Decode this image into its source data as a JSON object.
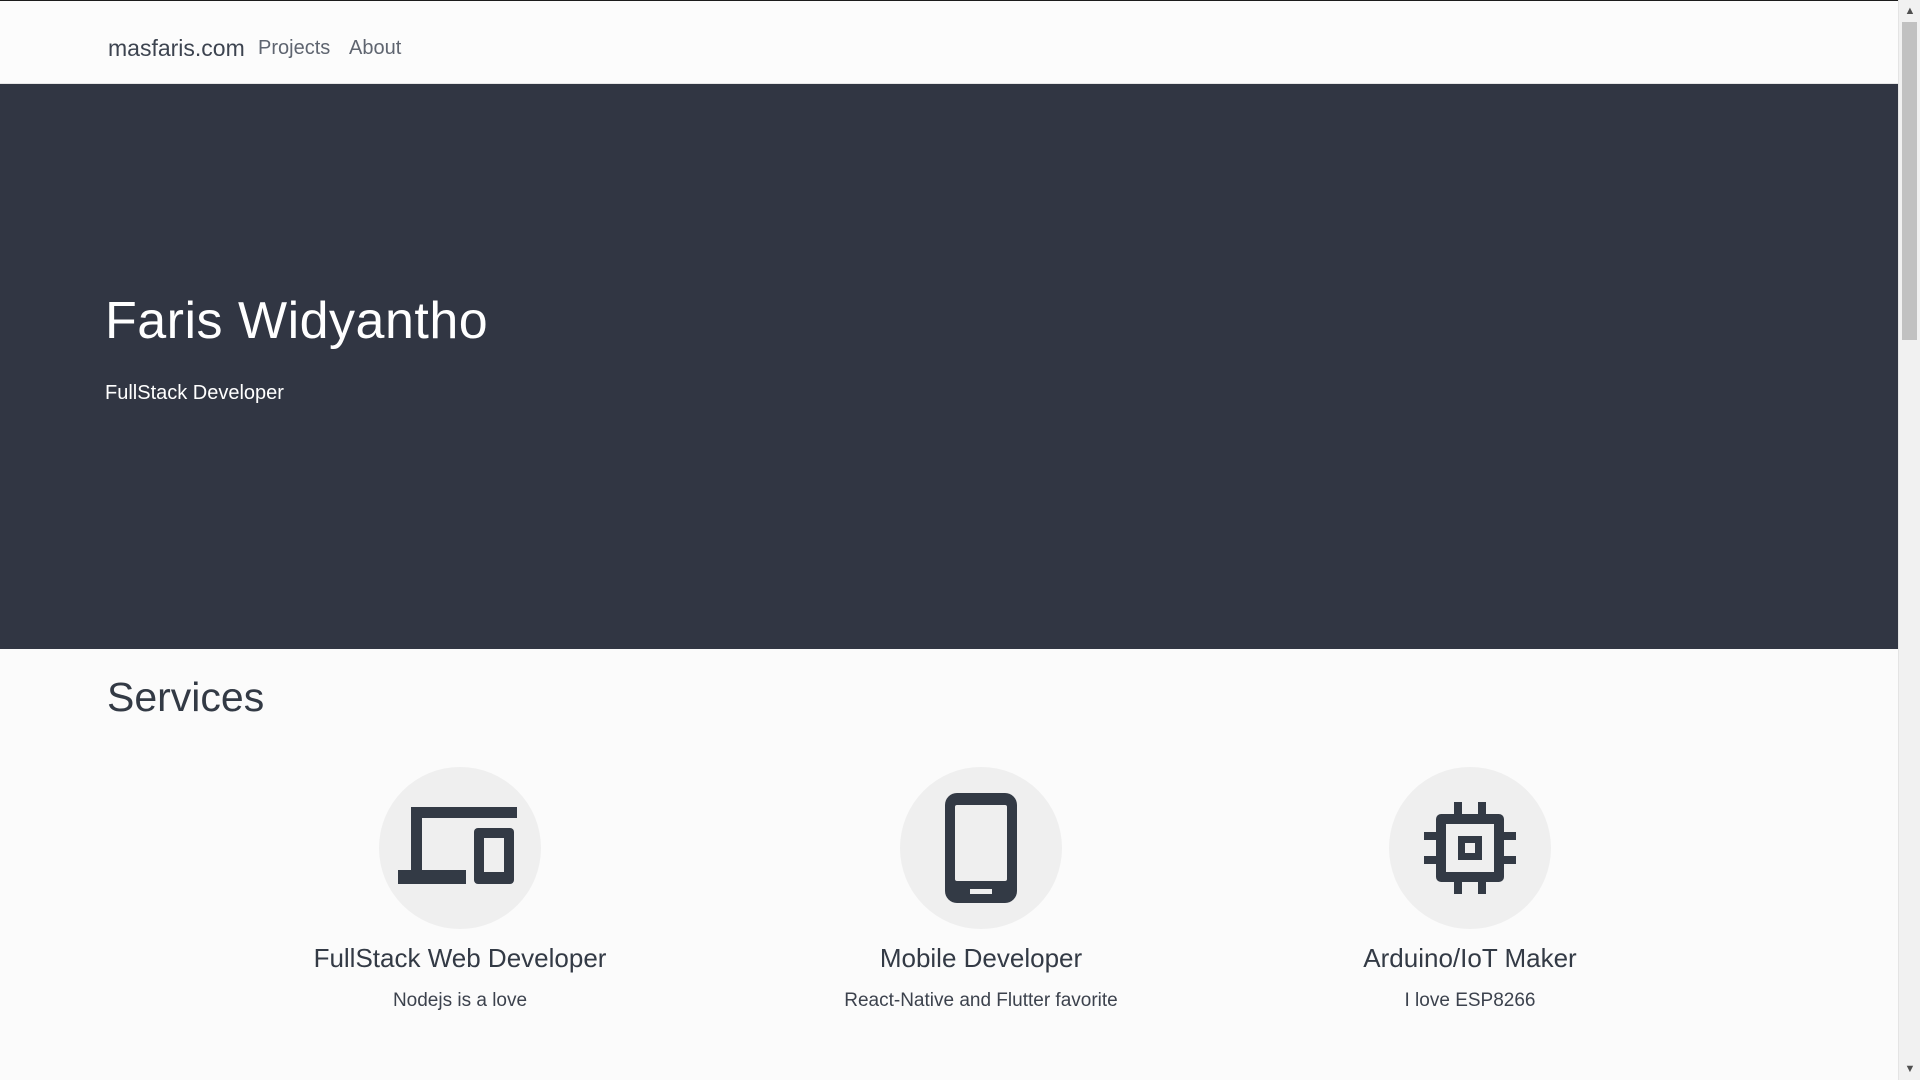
{
  "navbar": {
    "brand": "masfaris.com",
    "links": [
      {
        "label": "Projects"
      },
      {
        "label": "About"
      }
    ]
  },
  "hero": {
    "title": "Faris Widyantho",
    "subtitle": "FullStack Developer"
  },
  "services": {
    "title": "Services",
    "items": [
      {
        "icon": "devices-icon",
        "title": "FullStack Web Developer",
        "description": "Nodejs is a love"
      },
      {
        "icon": "smartphone-icon",
        "title": "Mobile Developer",
        "description": "React-Native and Flutter favorite"
      },
      {
        "icon": "chip-icon",
        "title": "Arduino/IoT Maker",
        "description": "I love ESP8266"
      }
    ]
  },
  "colors": {
    "hero_background": "#313643",
    "icon_color": "#333a45",
    "icon_circle": "#efefef"
  }
}
